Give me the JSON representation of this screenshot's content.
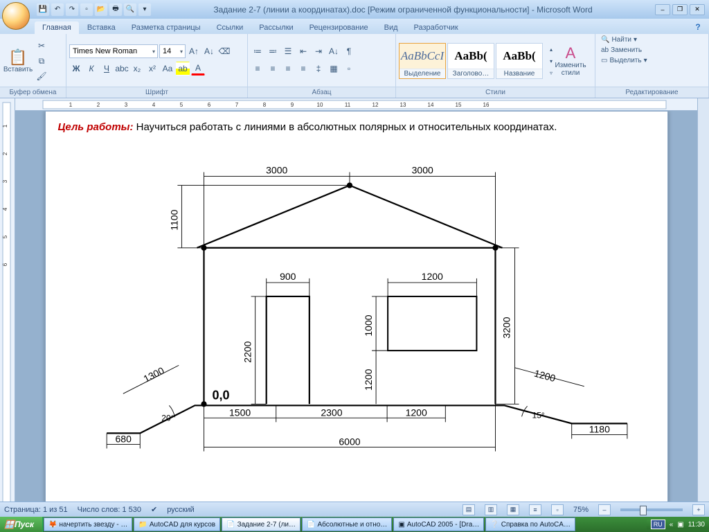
{
  "title": "Задание 2-7 (линии а координатах).doc [Режим ограниченной функциональности] - Microsoft Word",
  "tabs": {
    "t0": "Главная",
    "t1": "Вставка",
    "t2": "Разметка страницы",
    "t3": "Ссылки",
    "t4": "Рассылки",
    "t5": "Рецензирование",
    "t6": "Вид",
    "t7": "Разработчик"
  },
  "groups": {
    "clip": "Буфер обмена",
    "font": "Шрифт",
    "para": "Абзац",
    "styles": "Стили",
    "edit": "Редактирование"
  },
  "clipboard": {
    "paste": "Вставить"
  },
  "font": {
    "family": "Times New Roman",
    "size": "14"
  },
  "styles": {
    "preview": "AaBbCcI",
    "preview2": "AaBb(",
    "preview3": "AaBb(",
    "s0": "Выделение",
    "s1": "Заголово…",
    "s2": "Название",
    "change": "Изменить\nстили"
  },
  "editing": {
    "find": "Найти",
    "replace": "Заменить",
    "select": "Выделить"
  },
  "doc": {
    "goal_label": "Цель работы:",
    "goal_text": "  Научиться  работать  с линиями в  абсолютных полярных и относительных координатах."
  },
  "drawing": {
    "origin": "0,0",
    "dims": {
      "roof_l": "3000",
      "roof_r": "3000",
      "roof_h": "1100",
      "wall_h": "3200",
      "door_w": "900",
      "door_h": "2200",
      "win_w": "1200",
      "win_h": "1000",
      "win_y": "1200",
      "d1": "1500",
      "d2": "2300",
      "d3": "1200",
      "total": "6000",
      "ramp_l": "1300",
      "ramp_l2": "680",
      "ramp_la": "20°",
      "ramp_r": "1200",
      "ramp_r2": "1180",
      "ramp_ra": "15°"
    }
  },
  "status": {
    "page": "Страница: 1 из 51",
    "words": "Число слов: 1 530",
    "lang": "русский",
    "zoom": "75%"
  },
  "taskbar": {
    "start": "Пуск",
    "b0": "начертить звезду - …",
    "b1": "AutoCAD для курсов",
    "b2": "Задание 2-7 (ли…",
    "b3": "Абсолютные и отно…",
    "b4": "AutoCAD 2005 - [Dra…",
    "b5": "Справка по AutoCA…",
    "lang": "RU",
    "time": "11:30"
  }
}
